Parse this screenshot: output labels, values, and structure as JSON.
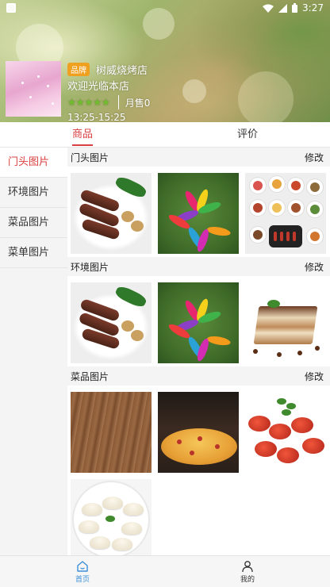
{
  "status_bar": {
    "time": "3:27"
  },
  "shop": {
    "brand_tag": "品牌",
    "name": "树威烧烤店",
    "welcome": "欢迎光临本店",
    "rating_stars": "★★★★★",
    "monthly_sales": "月售0",
    "hours": "13:25-15:25"
  },
  "tabs": [
    {
      "label": "商品",
      "active": true
    },
    {
      "label": "评价",
      "active": false
    }
  ],
  "sidebar": {
    "items": [
      {
        "label": "门头图片",
        "active": true
      },
      {
        "label": "环境图片",
        "active": false
      },
      {
        "label": "菜品图片",
        "active": false
      },
      {
        "label": "菜单图片",
        "active": false
      }
    ]
  },
  "sections": [
    {
      "title": "门头图片",
      "edit_label": "修改",
      "images": [
        "lamb-chops-photo",
        "feathers-photo",
        "bbq-dishes-photo"
      ]
    },
    {
      "title": "环境图片",
      "edit_label": "修改",
      "images": [
        "lamb-chops-photo",
        "feathers-photo",
        "tiramisu-photo"
      ]
    },
    {
      "title": "菜品图片",
      "edit_label": "修改",
      "images": [
        "wood-floor-photo",
        "pizza-photo",
        "crayfish-photo",
        "dumplings-photo"
      ]
    }
  ],
  "bottom_nav": [
    {
      "label": "首页",
      "icon": "home-icon",
      "active": true
    },
    {
      "label": "我的",
      "icon": "person-icon",
      "active": false
    }
  ],
  "colors": {
    "accent": "#d94040",
    "brand_tag": "#f0a020",
    "rating": "#6fbf2c",
    "nav_active": "#3a8fd9"
  }
}
